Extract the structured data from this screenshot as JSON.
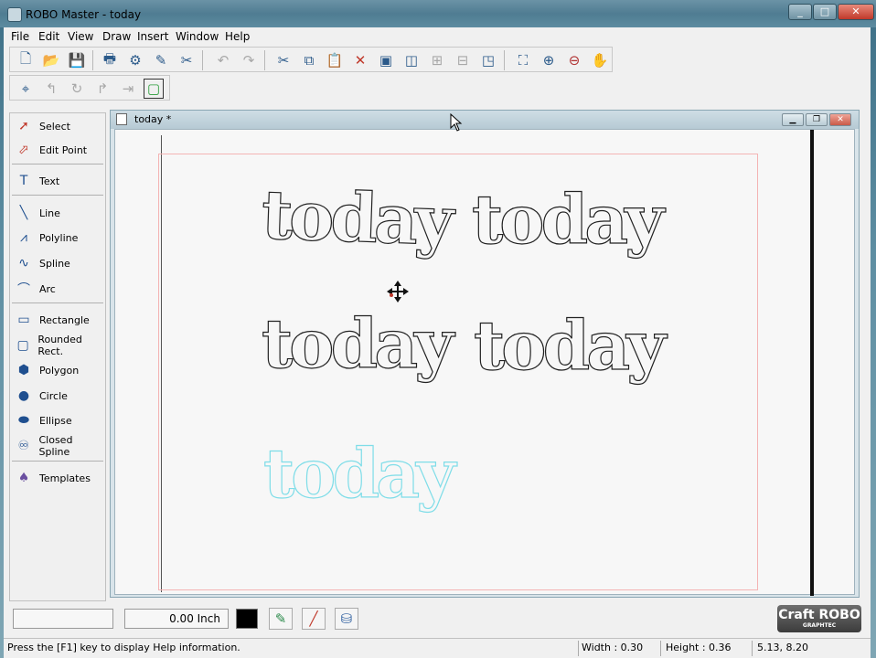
{
  "window": {
    "title": "ROBO Master - today",
    "controls": [
      "_",
      "□",
      "✕"
    ]
  },
  "menu": [
    "File",
    "Edit",
    "View",
    "Draw",
    "Insert",
    "Window",
    "Help"
  ],
  "toolbar1": [
    "new-icon",
    "open-icon",
    "save-icon",
    "print-icon",
    "cut-settings-icon",
    "plot-icon",
    "test-icon",
    "undo-icon",
    "redo-icon",
    "cut-icon",
    "copy-icon",
    "paste-icon",
    "delete-icon",
    "group-icon",
    "ungroup-icon",
    "align-icon",
    "weld-icon",
    "resize-icon",
    "fit-page-icon",
    "zoom-in-icon",
    "zoom-out-icon",
    "pan-icon"
  ],
  "toolbar2": [
    "registration-icon",
    "rotate-left-icon",
    "rotate-right-icon",
    "flip-icon",
    "mirror-icon",
    "frame-icon"
  ],
  "tools": [
    {
      "label": "Select",
      "icon": "select-arrow-icon"
    },
    {
      "label": "Edit Point",
      "icon": "edit-point-icon"
    },
    {
      "label": "Text",
      "icon": "text-icon"
    },
    {
      "label": "Line",
      "icon": "line-icon"
    },
    {
      "label": "Polyline",
      "icon": "polyline-icon"
    },
    {
      "label": "Spline",
      "icon": "spline-icon"
    },
    {
      "label": "Arc",
      "icon": "arc-icon"
    },
    {
      "label": "Rectangle",
      "icon": "rectangle-icon"
    },
    {
      "label": "Rounded Rect.",
      "icon": "rounded-rect-icon"
    },
    {
      "label": "Polygon",
      "icon": "polygon-icon"
    },
    {
      "label": "Circle",
      "icon": "circle-icon"
    },
    {
      "label": "Ellipse",
      "icon": "ellipse-icon"
    },
    {
      "label": "Closed Spline",
      "icon": "closed-spline-icon"
    },
    {
      "label": "Templates",
      "icon": "templates-icon"
    }
  ],
  "document": {
    "title": "today *",
    "words": [
      "today",
      "today",
      "today",
      "today",
      "today"
    ]
  },
  "props": {
    "offset_value": "0.00 Inch",
    "line_color": "#000000"
  },
  "logo": {
    "name": "Craft ROBO",
    "sub": "GRAPHTEC"
  },
  "status": {
    "help": "Press the [F1] key to display Help information.",
    "width": "Width : 0.30",
    "height": "Height : 0.36",
    "coords": "5.13, 8.20"
  },
  "colors": {
    "cyan_outline": "#7fdde8",
    "margin_red": "#f4b4b4"
  }
}
